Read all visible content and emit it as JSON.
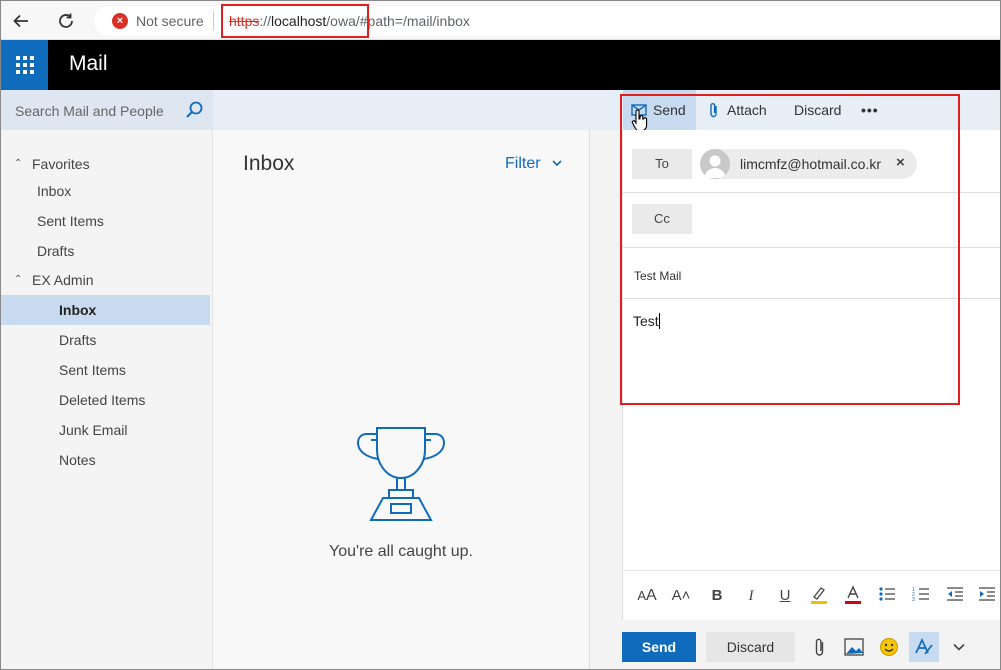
{
  "browser": {
    "security_text": "Not secure",
    "url_scheme": "https",
    "url_separator": "://",
    "url_host": "localhost",
    "url_path": "/owa/",
    "url_hash": "#path=/mail/inbox"
  },
  "suite": {
    "app_title": "Mail"
  },
  "search": {
    "placeholder": "Search Mail and People"
  },
  "commands": {
    "send": "Send",
    "attach": "Attach",
    "discard": "Discard",
    "more": "•••"
  },
  "folders": {
    "favorites_label": "Favorites",
    "favorites": [
      "Inbox",
      "Sent Items",
      "Drafts"
    ],
    "account_label": "EX Admin",
    "account_folders": [
      "Inbox",
      "Drafts",
      "Sent Items",
      "Deleted Items",
      "Junk Email",
      "Notes"
    ],
    "active": "Inbox"
  },
  "message_list": {
    "title": "Inbox",
    "filter": "Filter",
    "empty_message": "You're all caught up."
  },
  "compose": {
    "to_label": "To",
    "cc_label": "Cc",
    "recipient": "limcmfz@hotmail.co.kr",
    "remove_recipient": "×",
    "subject": "Test Mail",
    "body": "Test",
    "send_button": "Send",
    "discard_button": "Discard"
  },
  "colors": {
    "accent": "#0f6cbd",
    "highlight": "#e02020",
    "selection": "#c7daf0"
  }
}
